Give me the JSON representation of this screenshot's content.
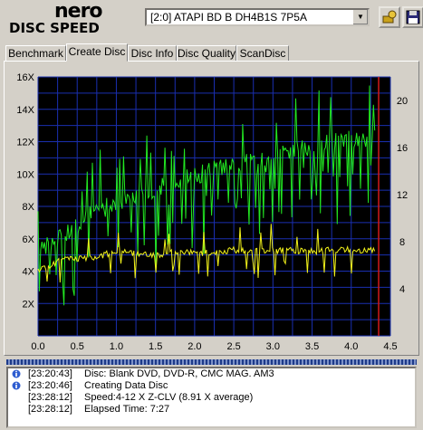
{
  "app": {
    "logo_top": "nero",
    "logo_bottom": "DISC SPEED"
  },
  "drive": {
    "selected": "[2:0]  ATAPI BD  B  DH4B1S 7P5A"
  },
  "tabs": [
    {
      "label": "Benchmark",
      "active": false
    },
    {
      "label": "Create Disc",
      "active": true
    },
    {
      "label": "Disc Info",
      "active": false
    },
    {
      "label": "Disc Quality",
      "active": false
    },
    {
      "label": "ScanDisc",
      "active": false
    }
  ],
  "chart_data": {
    "type": "line",
    "x_ticks": [
      "0.0",
      "0.5",
      "1.0",
      "1.5",
      "2.0",
      "2.5",
      "3.0",
      "3.5",
      "4.0",
      "4.5"
    ],
    "y_left_ticks": [
      "2X",
      "4X",
      "6X",
      "8X",
      "10X",
      "12X",
      "14X",
      "16X"
    ],
    "y_right_ticks": [
      "4",
      "8",
      "12",
      "16",
      "20"
    ],
    "xlim": [
      0,
      4.5
    ],
    "ylim_left": [
      0,
      16
    ],
    "ylim_right": [
      0,
      22
    ],
    "end_marker_x": 4.35,
    "colors": {
      "background": "#000000",
      "grid": "#1a2fb0",
      "write_speed": "#22e822",
      "cpu": "#f2f21a",
      "marker": "#d41a1a"
    },
    "series": [
      {
        "key": "write_speed",
        "x": [
          0.0,
          0.1,
          0.2,
          0.3,
          0.4,
          0.5,
          0.6,
          0.7,
          0.8,
          0.9,
          1.0,
          1.1,
          1.2,
          1.3,
          1.4,
          1.5,
          1.6,
          1.7,
          1.8,
          1.9,
          2.0,
          2.1,
          2.2,
          2.3,
          2.4,
          2.5,
          2.6,
          2.7,
          2.8,
          2.9,
          3.0,
          3.1,
          3.2,
          3.3,
          3.4,
          3.5,
          3.6,
          3.7,
          3.8,
          3.9,
          4.0,
          4.1,
          4.2,
          4.3
        ],
        "values": [
          5.0,
          5.7,
          6.0,
          6.3,
          6.6,
          7.0,
          7.3,
          7.6,
          7.9,
          8.1,
          8.3,
          8.5,
          8.7,
          8.8,
          8.9,
          9.1,
          9.3,
          9.4,
          9.6,
          9.8,
          10.0,
          10.1,
          10.2,
          10.4,
          10.5,
          10.7,
          10.8,
          10.9,
          11.0,
          11.1,
          11.2,
          11.3,
          11.5,
          11.6,
          11.7,
          11.8,
          11.9,
          12.0,
          12.1,
          12.1,
          12.2,
          12.2,
          12.2,
          12.2
        ]
      },
      {
        "key": "cpu",
        "x": [
          0.0,
          0.25,
          0.5,
          0.75,
          1.0,
          1.25,
          1.5,
          1.75,
          2.0,
          2.25,
          2.5,
          2.75,
          3.0,
          3.25,
          3.5,
          3.75,
          4.0,
          4.25,
          4.3
        ],
        "values": [
          4.0,
          4.6,
          4.8,
          4.9,
          5.2,
          5.1,
          5.0,
          5.2,
          5.1,
          5.2,
          5.3,
          5.2,
          5.3,
          5.3,
          5.2,
          5.3,
          5.3,
          5.3,
          5.2
        ]
      }
    ]
  },
  "log": [
    {
      "time": "[23:20:43]",
      "msg": "Disc: Blank DVD, DVD-R, CMC MAG. AM3",
      "icon": "info-icon"
    },
    {
      "time": "[23:20:46]",
      "msg": "Creating Data Disc",
      "icon": "info-icon"
    },
    {
      "time": "[23:28:12]",
      "msg": "Speed:4-12 X Z-CLV (8.91 X average)",
      "icon": ""
    },
    {
      "time": "[23:28:12]",
      "msg": "Elapsed Time:  7:27",
      "icon": ""
    }
  ]
}
